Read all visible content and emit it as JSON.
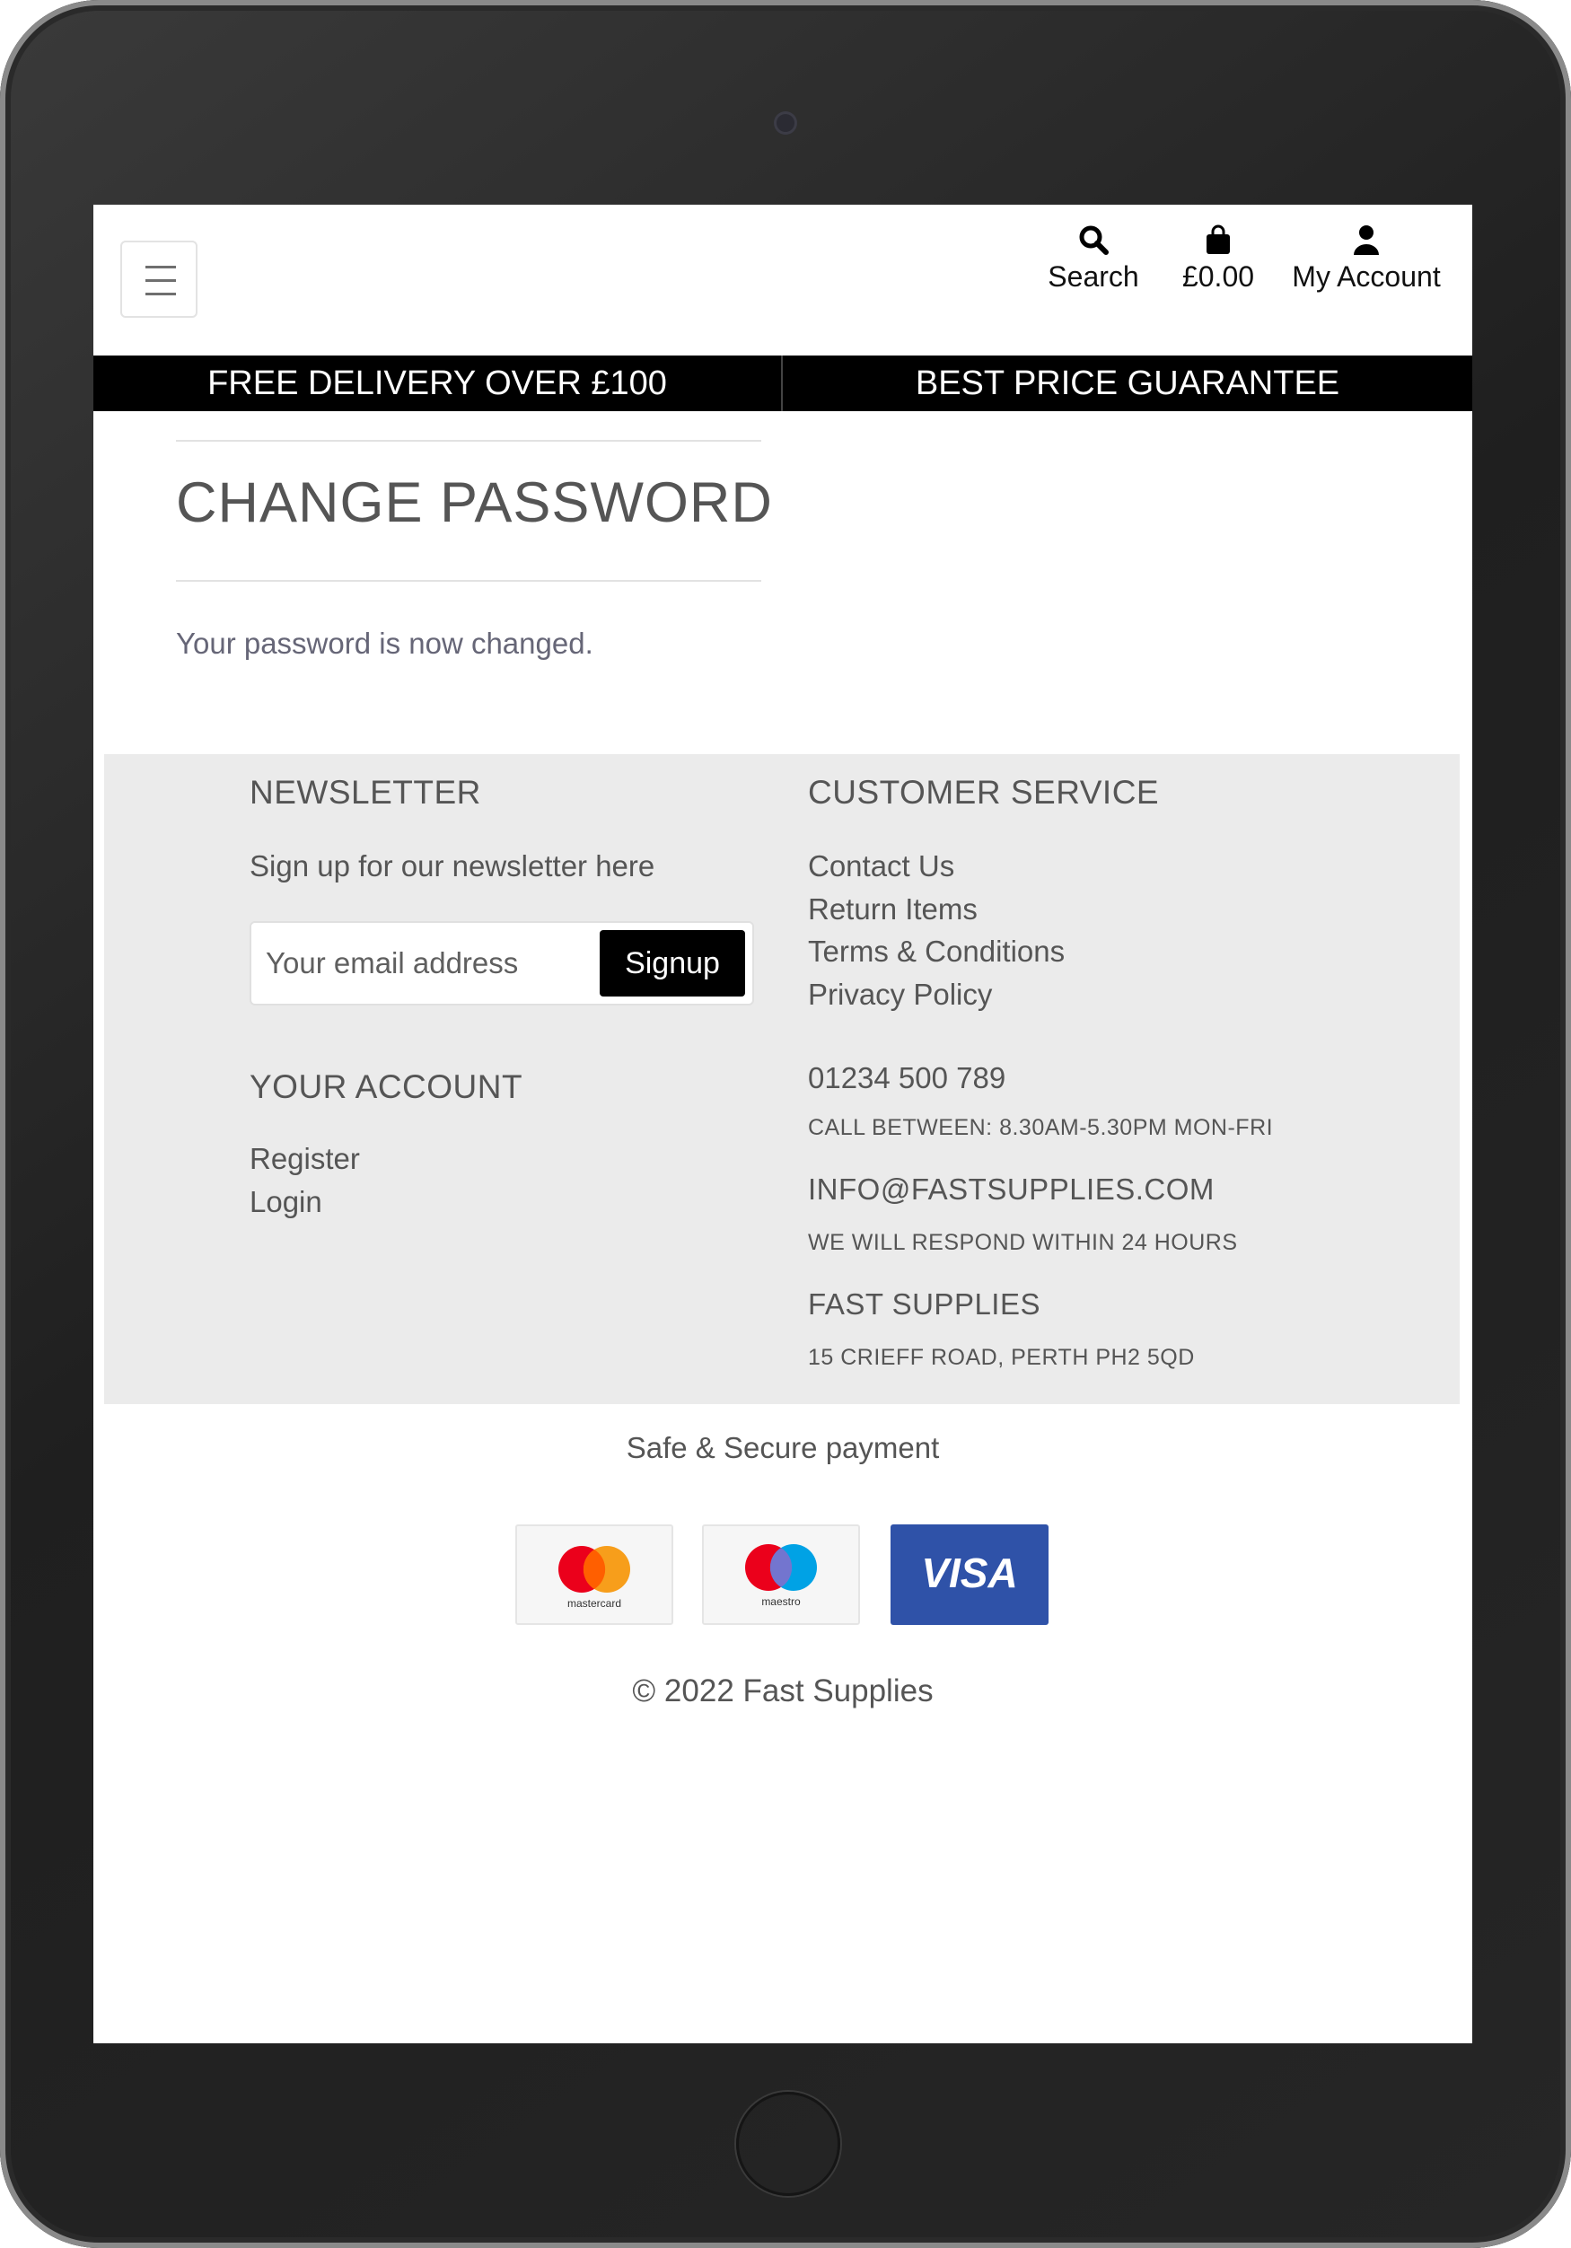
{
  "header": {
    "nav": {
      "search_label": "Search",
      "cart_total": "£0.00",
      "account_label": "My Account"
    },
    "icons": {
      "menu": "hamburger-icon",
      "search": "search-icon",
      "cart": "shopping-bag-icon",
      "account": "user-icon"
    }
  },
  "promo": {
    "left": "FREE DELIVERY OVER £100",
    "right": "BEST PRICE GUARANTEE"
  },
  "main": {
    "title": "CHANGE PASSWORD",
    "message": "Your password is now changed."
  },
  "footer": {
    "newsletter": {
      "heading": "NEWSLETTER",
      "text": "Sign up for our newsletter here",
      "placeholder": "Your email address",
      "button": "Signup"
    },
    "account": {
      "heading": "YOUR ACCOUNT",
      "links": [
        "Register",
        "Login"
      ]
    },
    "customer_service": {
      "heading": "CUSTOMER SERVICE",
      "links": [
        "Contact Us",
        "Return Items",
        "Terms & Conditions",
        "Privacy Policy"
      ],
      "phone": "01234 500 789",
      "phone_note": "CALL BETWEEN: 8.30AM-5.30PM MON-FRI",
      "email": "INFO@FASTSUPPLIES.COM",
      "email_note": "WE WILL RESPOND WITHIN 24 HOURS",
      "company": "FAST SUPPLIES",
      "address": "15 CRIEFF ROAD, PERTH PH2 5QD"
    }
  },
  "payments": {
    "heading": "Safe & Secure payment",
    "cards": [
      "mastercard",
      "maestro",
      "VISA"
    ]
  },
  "copyright": "© 2022 Fast Supplies",
  "colors": {
    "promo_bg": "#000000",
    "footer_bg": "#ebebeb",
    "visa_blue": "#2f52a8",
    "mc_red": "#eb001b",
    "mc_orange": "#f79e1b",
    "maestro_blue": "#00a2e5"
  }
}
